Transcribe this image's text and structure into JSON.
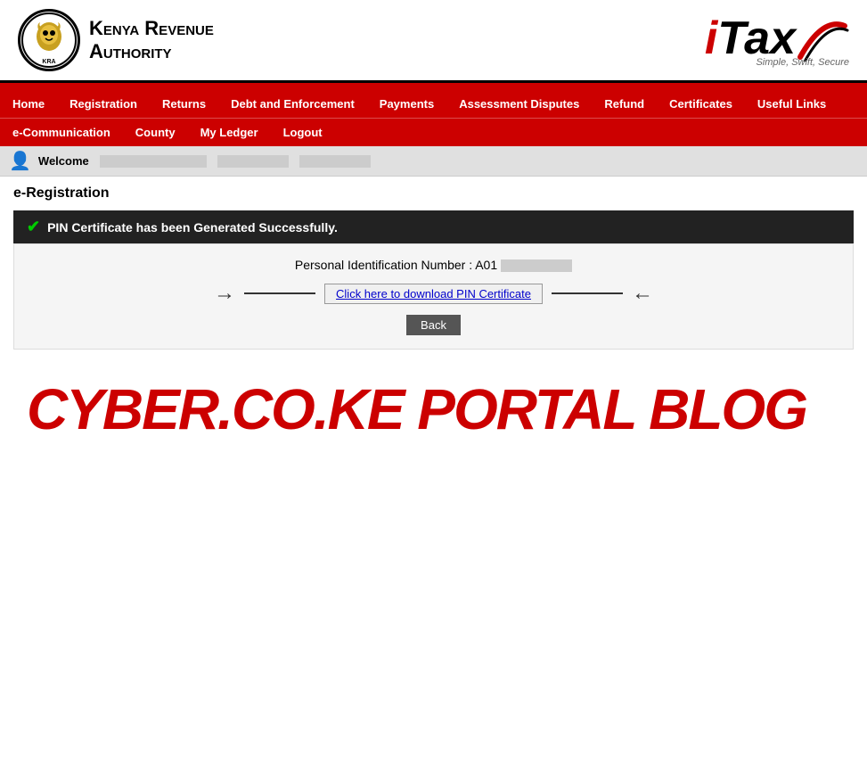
{
  "header": {
    "kra_name_line1": "Kenya Revenue",
    "kra_name_line2": "Authority",
    "itax_i": "i",
    "itax_tax": "Tax",
    "itax_tagline": "Simple, Swift, Secure"
  },
  "nav": {
    "row1": [
      {
        "label": "Home",
        "id": "home"
      },
      {
        "label": "Registration",
        "id": "registration"
      },
      {
        "label": "Returns",
        "id": "returns"
      },
      {
        "label": "Debt and Enforcement",
        "id": "debt"
      },
      {
        "label": "Payments",
        "id": "payments"
      },
      {
        "label": "Assessment Disputes",
        "id": "disputes"
      },
      {
        "label": "Refund",
        "id": "refund"
      },
      {
        "label": "Certificates",
        "id": "certificates"
      },
      {
        "label": "Useful Links",
        "id": "useful"
      }
    ],
    "row2": [
      {
        "label": "e-Communication",
        "id": "ecomm"
      },
      {
        "label": "County",
        "id": "county"
      },
      {
        "label": "My Ledger",
        "id": "ledger"
      },
      {
        "label": "Logout",
        "id": "logout"
      }
    ]
  },
  "welcome": {
    "text": "Welcome"
  },
  "page": {
    "title_bold": "e-Registration",
    "success_message": "PIN Certificate has been Generated Successfully.",
    "pin_label": "Personal Identification Number : A01",
    "download_link": "Click here to download PIN Certificate",
    "back_button": "Back"
  },
  "watermark": {
    "text": "CYBER.CO.KE PORTAL BLOG"
  }
}
